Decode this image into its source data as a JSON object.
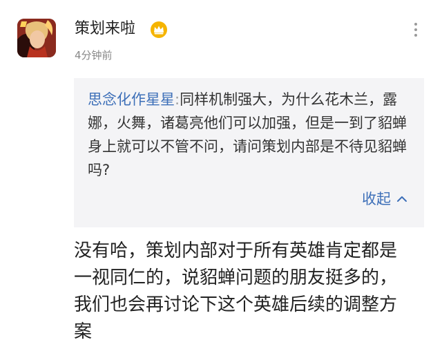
{
  "author": {
    "name": "策划来啦",
    "badge_icon": "crown-badge-icon",
    "badge_color": "#f5b400",
    "time": "4分钟前"
  },
  "menu": {
    "icon": "more-vertical-icon"
  },
  "quote": {
    "user": "思念化作星星",
    "separator": ":",
    "text": "同样机制强大，为什么花木兰，露娜，火舞，诸葛亮他们可以加强，但是一到了貂蝉身上就可以不管不问，请问策划内部是不待见貂蝉吗?",
    "collapse_label": "收起",
    "collapse_icon": "chevron-up-icon"
  },
  "reply": {
    "text": "没有哈，策划内部对于所有英雄肯定都是一视同仁的，说貂蝉问题的朋友挺多的，我们也会再讨论下这个英雄后续的调整方案"
  },
  "colors": {
    "link": "#3d6fb8",
    "quote_bg": "#f4f4f6",
    "muted": "#888888"
  }
}
